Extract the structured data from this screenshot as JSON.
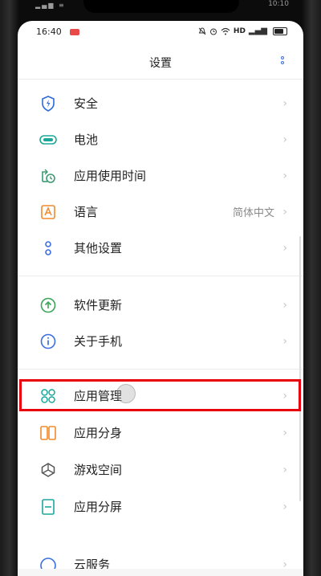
{
  "outer_status": {
    "left_icons": "▂▄▆ ≡",
    "time": "10:10"
  },
  "statusbar": {
    "time": "16:40",
    "icons_right": [
      "bell-off-icon",
      "alarm-icon",
      "wifi-icon"
    ],
    "hd_label": "HD",
    "signal": "▂▄▆"
  },
  "header": {
    "title": "设置"
  },
  "items": [
    {
      "label": "安全",
      "icon": "shield-icon",
      "color": "#2f6bd8"
    },
    {
      "label": "电池",
      "icon": "battery-icon",
      "color": "#1ba89b"
    },
    {
      "label": "应用使用时间",
      "icon": "app-time-icon",
      "color": "#3d9a73"
    },
    {
      "label": "语言",
      "value": "简体中文",
      "icon": "language-icon",
      "color": "#f08a2a"
    },
    {
      "label": "其他设置",
      "icon": "other-settings-icon",
      "color": "#3b6fe0"
    },
    {
      "label": "软件更新",
      "icon": "update-icon",
      "color": "#3aa657"
    },
    {
      "label": "关于手机",
      "icon": "info-icon",
      "color": "#3b6fe0"
    },
    {
      "label": "应用管理",
      "icon": "app-management-icon",
      "color": "#1ba89b"
    },
    {
      "label": "应用分身",
      "icon": "app-clone-icon",
      "color": "#f08a2a"
    },
    {
      "label": "游戏空间",
      "icon": "game-space-icon",
      "color": "#555555"
    },
    {
      "label": "应用分屏",
      "icon": "split-screen-icon",
      "color": "#1ba89b"
    },
    {
      "label": "云服务",
      "icon": "cloud-service-icon",
      "color": "#3b6fe0"
    }
  ],
  "chevron": "›",
  "highlight_color": "#e8000d"
}
